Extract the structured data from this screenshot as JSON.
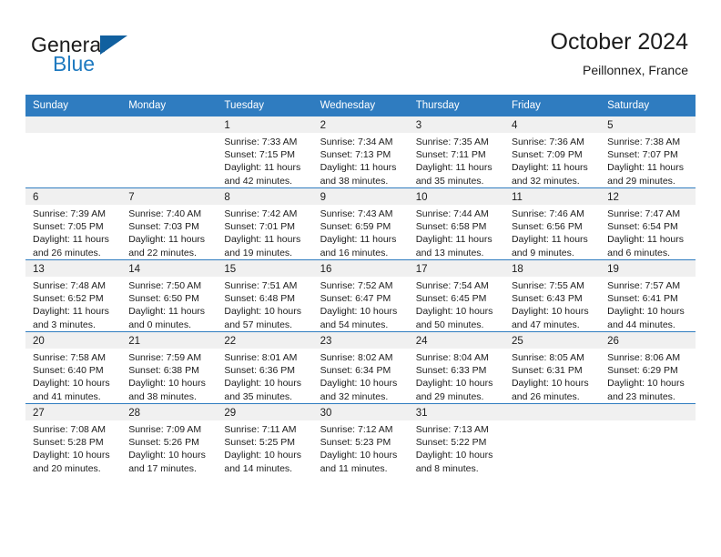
{
  "brand": {
    "name_top": "General",
    "name_bottom": "Blue",
    "accent_color": "#11609f",
    "blue_text_color": "#1f7ac0"
  },
  "header": {
    "title": "October 2024",
    "subtitle": "Peillonnex, France"
  },
  "theme": {
    "header_row_bg": "#2f7cc0",
    "daynum_band_bg": "#f0f0f0",
    "grid_line": "#2f7cc0",
    "text": "#1c1c1c"
  },
  "weekday_headers": [
    "Sunday",
    "Monday",
    "Tuesday",
    "Wednesday",
    "Thursday",
    "Friday",
    "Saturday"
  ],
  "weeks": [
    [
      {
        "day": "",
        "empty": true,
        "sunrise": "",
        "sunset": "",
        "daylight_line1": "",
        "daylight_line2": ""
      },
      {
        "day": "",
        "empty": true,
        "sunrise": "",
        "sunset": "",
        "daylight_line1": "",
        "daylight_line2": ""
      },
      {
        "day": "1",
        "empty": false,
        "sunrise": "Sunrise: 7:33 AM",
        "sunset": "Sunset: 7:15 PM",
        "daylight_line1": "Daylight: 11 hours",
        "daylight_line2": "and 42 minutes."
      },
      {
        "day": "2",
        "empty": false,
        "sunrise": "Sunrise: 7:34 AM",
        "sunset": "Sunset: 7:13 PM",
        "daylight_line1": "Daylight: 11 hours",
        "daylight_line2": "and 38 minutes."
      },
      {
        "day": "3",
        "empty": false,
        "sunrise": "Sunrise: 7:35 AM",
        "sunset": "Sunset: 7:11 PM",
        "daylight_line1": "Daylight: 11 hours",
        "daylight_line2": "and 35 minutes."
      },
      {
        "day": "4",
        "empty": false,
        "sunrise": "Sunrise: 7:36 AM",
        "sunset": "Sunset: 7:09 PM",
        "daylight_line1": "Daylight: 11 hours",
        "daylight_line2": "and 32 minutes."
      },
      {
        "day": "5",
        "empty": false,
        "sunrise": "Sunrise: 7:38 AM",
        "sunset": "Sunset: 7:07 PM",
        "daylight_line1": "Daylight: 11 hours",
        "daylight_line2": "and 29 minutes."
      }
    ],
    [
      {
        "day": "6",
        "empty": false,
        "sunrise": "Sunrise: 7:39 AM",
        "sunset": "Sunset: 7:05 PM",
        "daylight_line1": "Daylight: 11 hours",
        "daylight_line2": "and 26 minutes."
      },
      {
        "day": "7",
        "empty": false,
        "sunrise": "Sunrise: 7:40 AM",
        "sunset": "Sunset: 7:03 PM",
        "daylight_line1": "Daylight: 11 hours",
        "daylight_line2": "and 22 minutes."
      },
      {
        "day": "8",
        "empty": false,
        "sunrise": "Sunrise: 7:42 AM",
        "sunset": "Sunset: 7:01 PM",
        "daylight_line1": "Daylight: 11 hours",
        "daylight_line2": "and 19 minutes."
      },
      {
        "day": "9",
        "empty": false,
        "sunrise": "Sunrise: 7:43 AM",
        "sunset": "Sunset: 6:59 PM",
        "daylight_line1": "Daylight: 11 hours",
        "daylight_line2": "and 16 minutes."
      },
      {
        "day": "10",
        "empty": false,
        "sunrise": "Sunrise: 7:44 AM",
        "sunset": "Sunset: 6:58 PM",
        "daylight_line1": "Daylight: 11 hours",
        "daylight_line2": "and 13 minutes."
      },
      {
        "day": "11",
        "empty": false,
        "sunrise": "Sunrise: 7:46 AM",
        "sunset": "Sunset: 6:56 PM",
        "daylight_line1": "Daylight: 11 hours",
        "daylight_line2": "and 9 minutes."
      },
      {
        "day": "12",
        "empty": false,
        "sunrise": "Sunrise: 7:47 AM",
        "sunset": "Sunset: 6:54 PM",
        "daylight_line1": "Daylight: 11 hours",
        "daylight_line2": "and 6 minutes."
      }
    ],
    [
      {
        "day": "13",
        "empty": false,
        "sunrise": "Sunrise: 7:48 AM",
        "sunset": "Sunset: 6:52 PM",
        "daylight_line1": "Daylight: 11 hours",
        "daylight_line2": "and 3 minutes."
      },
      {
        "day": "14",
        "empty": false,
        "sunrise": "Sunrise: 7:50 AM",
        "sunset": "Sunset: 6:50 PM",
        "daylight_line1": "Daylight: 11 hours",
        "daylight_line2": "and 0 minutes."
      },
      {
        "day": "15",
        "empty": false,
        "sunrise": "Sunrise: 7:51 AM",
        "sunset": "Sunset: 6:48 PM",
        "daylight_line1": "Daylight: 10 hours",
        "daylight_line2": "and 57 minutes."
      },
      {
        "day": "16",
        "empty": false,
        "sunrise": "Sunrise: 7:52 AM",
        "sunset": "Sunset: 6:47 PM",
        "daylight_line1": "Daylight: 10 hours",
        "daylight_line2": "and 54 minutes."
      },
      {
        "day": "17",
        "empty": false,
        "sunrise": "Sunrise: 7:54 AM",
        "sunset": "Sunset: 6:45 PM",
        "daylight_line1": "Daylight: 10 hours",
        "daylight_line2": "and 50 minutes."
      },
      {
        "day": "18",
        "empty": false,
        "sunrise": "Sunrise: 7:55 AM",
        "sunset": "Sunset: 6:43 PM",
        "daylight_line1": "Daylight: 10 hours",
        "daylight_line2": "and 47 minutes."
      },
      {
        "day": "19",
        "empty": false,
        "sunrise": "Sunrise: 7:57 AM",
        "sunset": "Sunset: 6:41 PM",
        "daylight_line1": "Daylight: 10 hours",
        "daylight_line2": "and 44 minutes."
      }
    ],
    [
      {
        "day": "20",
        "empty": false,
        "sunrise": "Sunrise: 7:58 AM",
        "sunset": "Sunset: 6:40 PM",
        "daylight_line1": "Daylight: 10 hours",
        "daylight_line2": "and 41 minutes."
      },
      {
        "day": "21",
        "empty": false,
        "sunrise": "Sunrise: 7:59 AM",
        "sunset": "Sunset: 6:38 PM",
        "daylight_line1": "Daylight: 10 hours",
        "daylight_line2": "and 38 minutes."
      },
      {
        "day": "22",
        "empty": false,
        "sunrise": "Sunrise: 8:01 AM",
        "sunset": "Sunset: 6:36 PM",
        "daylight_line1": "Daylight: 10 hours",
        "daylight_line2": "and 35 minutes."
      },
      {
        "day": "23",
        "empty": false,
        "sunrise": "Sunrise: 8:02 AM",
        "sunset": "Sunset: 6:34 PM",
        "daylight_line1": "Daylight: 10 hours",
        "daylight_line2": "and 32 minutes."
      },
      {
        "day": "24",
        "empty": false,
        "sunrise": "Sunrise: 8:04 AM",
        "sunset": "Sunset: 6:33 PM",
        "daylight_line1": "Daylight: 10 hours",
        "daylight_line2": "and 29 minutes."
      },
      {
        "day": "25",
        "empty": false,
        "sunrise": "Sunrise: 8:05 AM",
        "sunset": "Sunset: 6:31 PM",
        "daylight_line1": "Daylight: 10 hours",
        "daylight_line2": "and 26 minutes."
      },
      {
        "day": "26",
        "empty": false,
        "sunrise": "Sunrise: 8:06 AM",
        "sunset": "Sunset: 6:29 PM",
        "daylight_line1": "Daylight: 10 hours",
        "daylight_line2": "and 23 minutes."
      }
    ],
    [
      {
        "day": "27",
        "empty": false,
        "sunrise": "Sunrise: 7:08 AM",
        "sunset": "Sunset: 5:28 PM",
        "daylight_line1": "Daylight: 10 hours",
        "daylight_line2": "and 20 minutes."
      },
      {
        "day": "28",
        "empty": false,
        "sunrise": "Sunrise: 7:09 AM",
        "sunset": "Sunset: 5:26 PM",
        "daylight_line1": "Daylight: 10 hours",
        "daylight_line2": "and 17 minutes."
      },
      {
        "day": "29",
        "empty": false,
        "sunrise": "Sunrise: 7:11 AM",
        "sunset": "Sunset: 5:25 PM",
        "daylight_line1": "Daylight: 10 hours",
        "daylight_line2": "and 14 minutes."
      },
      {
        "day": "30",
        "empty": false,
        "sunrise": "Sunrise: 7:12 AM",
        "sunset": "Sunset: 5:23 PM",
        "daylight_line1": "Daylight: 10 hours",
        "daylight_line2": "and 11 minutes."
      },
      {
        "day": "31",
        "empty": false,
        "sunrise": "Sunrise: 7:13 AM",
        "sunset": "Sunset: 5:22 PM",
        "daylight_line1": "Daylight: 10 hours",
        "daylight_line2": "and 8 minutes."
      },
      {
        "day": "",
        "empty": true,
        "sunrise": "",
        "sunset": "",
        "daylight_line1": "",
        "daylight_line2": ""
      },
      {
        "day": "",
        "empty": true,
        "sunrise": "",
        "sunset": "",
        "daylight_line1": "",
        "daylight_line2": ""
      }
    ]
  ]
}
